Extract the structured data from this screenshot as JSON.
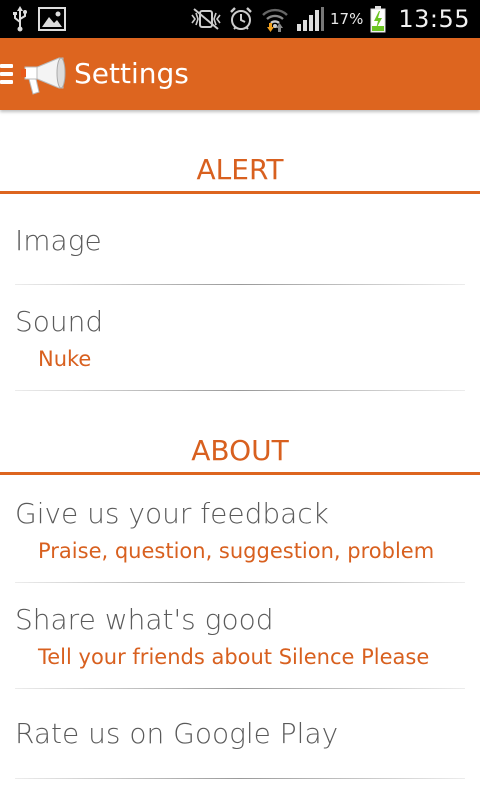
{
  "status_bar": {
    "battery_percent": "17%",
    "time": "13:55",
    "icons": [
      "usb-icon",
      "gallery-icon",
      "no-vibrate-icon",
      "alarm-icon",
      "wifi-icon",
      "signal-icon",
      "battery-charging-icon"
    ]
  },
  "app_bar": {
    "title": "Settings",
    "color": "#dd651f"
  },
  "sections": [
    {
      "header": "ALERT",
      "items": [
        {
          "title": "Image"
        },
        {
          "title": "Sound",
          "summary": "Nuke"
        }
      ]
    },
    {
      "header": "ABOUT",
      "items": [
        {
          "title": "Give us your feedback",
          "summary": "Praise, question, suggestion, problem"
        },
        {
          "title": "Share what's good",
          "summary": "Tell your friends about Silence Please"
        },
        {
          "title": "Rate us on Google Play"
        }
      ]
    }
  ],
  "colors": {
    "accent": "#dd651f",
    "accent_text": "#d8601f",
    "title_text": "#5a5a5a"
  }
}
